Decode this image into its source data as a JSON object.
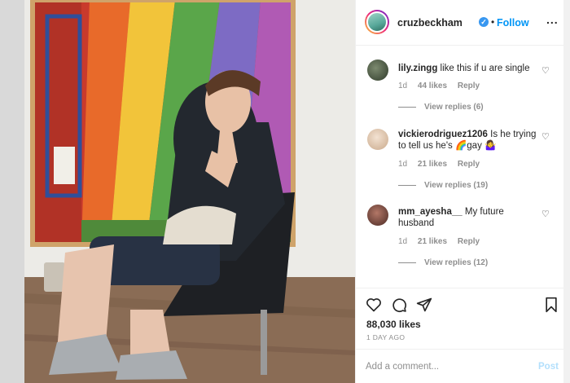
{
  "post": {
    "author": "cruzbeckham",
    "follow_label": "Follow",
    "dot": "•",
    "more_label": "...",
    "verified_mark": "✓",
    "likes_count": "88,030 likes",
    "timestamp": "1 DAY AGO"
  },
  "comments": [
    {
      "username": "lily.zingg",
      "text": "like this if u are single",
      "age": "1d",
      "likes": "44 likes",
      "reply_label": "Reply",
      "view_replies": "View replies (6)"
    },
    {
      "username": "vickierodriguez1206",
      "text": "Is he trying to tell us he's 🌈gay 🤷‍♀️",
      "age": "1d",
      "likes": "21 likes",
      "reply_label": "Reply",
      "view_replies": "View replies (19)"
    },
    {
      "username": "mm_ayesha__",
      "text": "My future husband",
      "age": "1d",
      "likes": "21 likes",
      "reply_label": "Reply",
      "view_replies": "View replies (12)"
    }
  ],
  "add_comment": {
    "placeholder": "Add a comment...",
    "post_label": "Post"
  },
  "icons": {
    "heart": "heart-icon",
    "comment": "comment-icon",
    "share": "share-icon",
    "bookmark": "bookmark-icon"
  },
  "colors": {
    "link_blue": "#0095f6",
    "post_disabled": "#b2dffc",
    "muted": "#8e8e8e",
    "text": "#262626"
  }
}
